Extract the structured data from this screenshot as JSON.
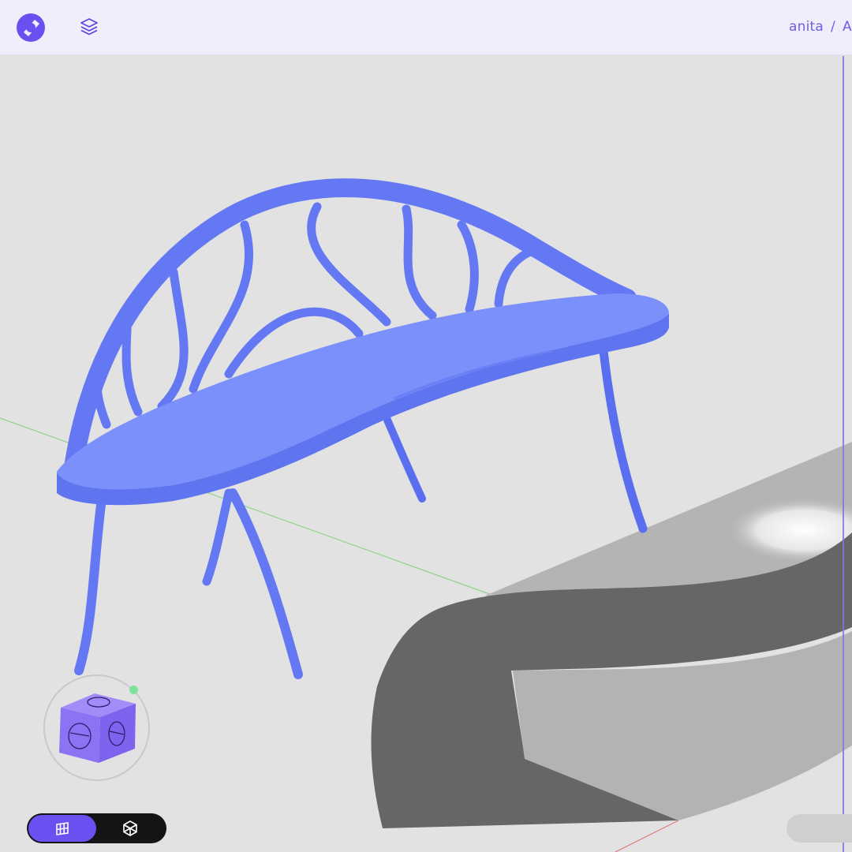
{
  "header": {
    "logo_icon": "app-logo-icon",
    "layers_icon": "layers-icon",
    "breadcrumb": {
      "user": "anita",
      "separator": "/",
      "project_truncated": "A"
    }
  },
  "viewport": {
    "model_color": "#6d82f4",
    "background": "#e2e2e2",
    "ground_object_color": "#6a6a6a"
  },
  "viewcube": {
    "icon": "view-cube-icon"
  },
  "mode_toggle": {
    "options": [
      {
        "icon": "grid-view-icon",
        "active": true
      },
      {
        "icon": "wireframe-cube-icon",
        "active": false
      }
    ]
  },
  "colors": {
    "accent": "#6b4ff0",
    "topbar": "#f0eefb",
    "breadcrumb_text": "#6c5fe0"
  }
}
